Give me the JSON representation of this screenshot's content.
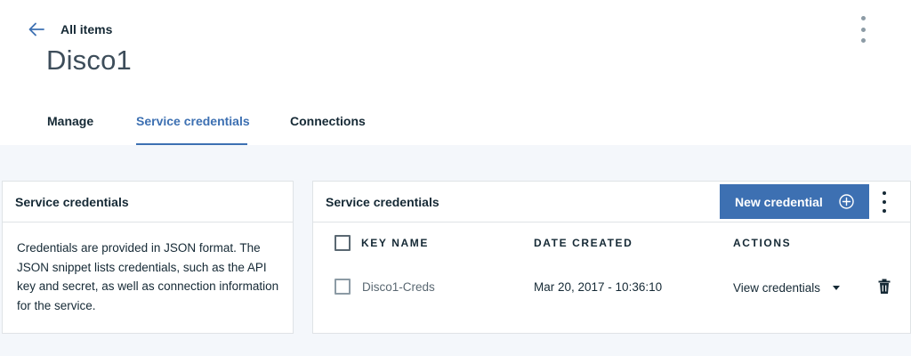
{
  "header": {
    "back_label": "All items",
    "title": "Disco1"
  },
  "tabs": [
    {
      "label": "Manage",
      "active": false
    },
    {
      "label": "Service credentials",
      "active": true
    },
    {
      "label": "Connections",
      "active": false
    }
  ],
  "left_panel": {
    "title": "Service credentials",
    "description": "Credentials are provided in JSON format. The JSON snippet lists credentials, such as the API key and secret, as well as connection information for the service."
  },
  "right_panel": {
    "title": "Service credentials",
    "new_button_label": "New credential",
    "columns": [
      "KEY NAME",
      "DATE CREATED",
      "ACTIONS"
    ],
    "rows": [
      {
        "key_name": "Disco1-Creds",
        "date_created": "Mar 20, 2017 - 10:36:10",
        "action": "View credentials"
      }
    ]
  },
  "icons": {
    "back": "arrow-left-icon",
    "overflow": "overflow-menu-icon",
    "add": "add-circle-icon",
    "dropdown": "caret-down-icon",
    "delete": "trash-icon"
  },
  "colors": {
    "accent": "#3d70b2",
    "background": "#f4f7fb",
    "text": "#152935"
  }
}
